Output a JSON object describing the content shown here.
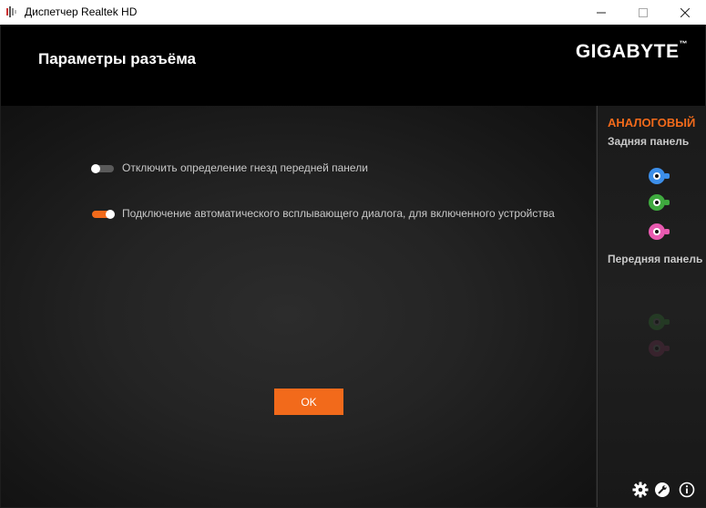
{
  "window": {
    "title": "Диспетчер Realtek HD"
  },
  "header": {
    "title": "Параметры разъёма",
    "brand": "GIGABYTE",
    "brand_mark": "™"
  },
  "options": [
    {
      "label": "Отключить определение гнезд передней панели",
      "enabled": false
    },
    {
      "label": "Подключение автоматического всплывающего диалога, для включенного устройства",
      "enabled": true
    }
  ],
  "ok_button": {
    "label": "OK"
  },
  "sidebar": {
    "heading": "АНАЛОГОВЫЙ",
    "rear_panel": {
      "label": "Задняя панель",
      "jacks": [
        {
          "icon": "line-in-jack-icon",
          "color": "#3c8ee8"
        },
        {
          "icon": "line-out-jack-icon",
          "color": "#3faa3f"
        },
        {
          "icon": "mic-in-jack-icon",
          "color": "#e85ab0"
        }
      ]
    },
    "front_panel": {
      "label": "Передняя панель",
      "jacks": [
        {
          "icon": "front-headphone-jack-icon",
          "color": "#2f6a2f",
          "active": false
        },
        {
          "icon": "front-mic-jack-icon",
          "color": "#6a2f4a",
          "active": false
        }
      ]
    }
  },
  "bottom_icons": [
    "gear-icon",
    "wrench-icon",
    "info-icon"
  ],
  "colors": {
    "accent": "#f26a1b",
    "header_bg": "#000000",
    "text": "#c8c8c8"
  }
}
